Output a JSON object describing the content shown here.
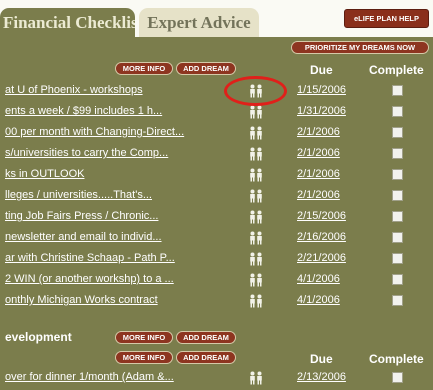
{
  "tabs": [
    {
      "label": "Financial Checklist",
      "active": true
    },
    {
      "label": "Expert Advice",
      "active": false
    }
  ],
  "help_button": "eLIFE PLAN HELP",
  "prioritize_button": "PRIORITIZE MY DREAMS NOW",
  "section1": {
    "more_info": "MORE INFO",
    "add_dream": "ADD DREAM",
    "due_header": "Due",
    "complete_header": "Complete",
    "rows": [
      {
        "text": "at U of Phoenix - workshops",
        "due": "1/15/2006",
        "icon": "people-icon"
      },
      {
        "text": "ents a week / $99 includes 1 h...",
        "due": "1/31/2006",
        "icon": "people-icon"
      },
      {
        "text": "00 per month with Changing-Direct...",
        "due": "2/1/2006",
        "icon": "people-icon"
      },
      {
        "text": "s/universities to carry the Comp...",
        "due": "2/1/2006",
        "icon": "people-icon"
      },
      {
        "text": "ks in OUTLOOK",
        "due": "2/1/2006",
        "icon": "people-icon"
      },
      {
        "text": "lleges / universities.....That's...",
        "due": "2/1/2006",
        "icon": "people-icon"
      },
      {
        "text": "ting Job Fairs Press / Chronic...",
        "due": "2/15/2006",
        "icon": "people-icon"
      },
      {
        "text": "newsletter and email to individ...",
        "due": "2/16/2006",
        "icon": "people-icon"
      },
      {
        "text": "ar with Christine Schaap - Path P...",
        "due": "2/21/2006",
        "icon": "people-icon"
      },
      {
        "text": "2 WIN (or another workshp) to a ...",
        "due": "4/1/2006",
        "icon": "people-icon"
      },
      {
        "text": "onthly Michigan Works contract",
        "due": "4/1/2006",
        "icon": "people-icon"
      }
    ]
  },
  "section2": {
    "title": "evelopment",
    "more_info": "MORE INFO",
    "add_dream": "ADD DREAM",
    "due_header": "Due",
    "complete_header": "Complete",
    "rows": [
      {
        "text": "over for dinner 1/month (Adam &...",
        "due": "2/13/2006",
        "icon": "people-icon"
      }
    ]
  },
  "colors": {
    "background": "#7b7d4c",
    "button": "#8d3520",
    "highlight_ellipse": "#e0201a"
  }
}
